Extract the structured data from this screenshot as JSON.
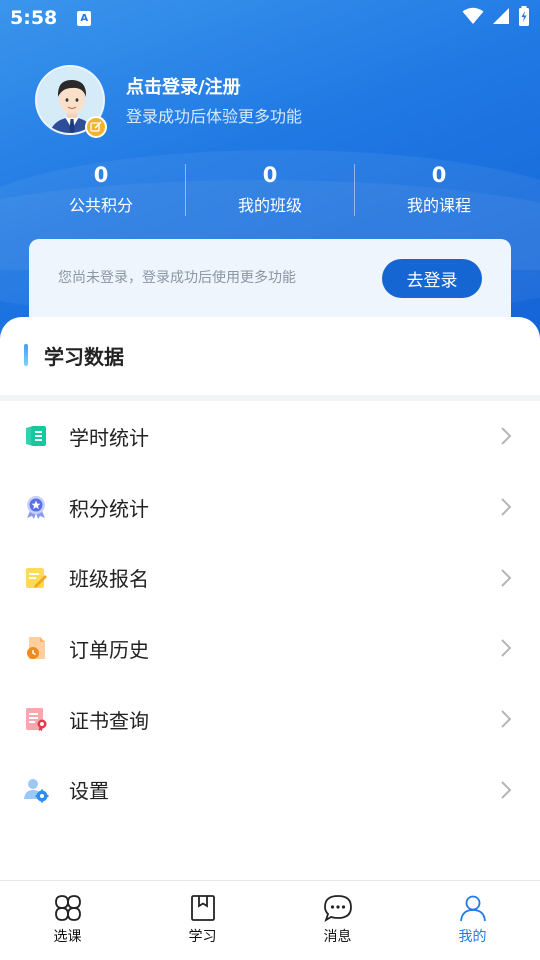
{
  "status_bar": {
    "time": "5:58",
    "notification_badge": "A"
  },
  "profile": {
    "title": "点击登录/注册",
    "subtitle": "登录成功后体验更多功能"
  },
  "stats": [
    {
      "value": "0",
      "label": "公共积分"
    },
    {
      "value": "0",
      "label": "我的班级"
    },
    {
      "value": "0",
      "label": "我的课程"
    }
  ],
  "login_prompt": {
    "text": "您尚未登录，登录成功后使用更多功能",
    "button": "去登录"
  },
  "section": {
    "title": "学习数据"
  },
  "menu": [
    {
      "label": "学时统计",
      "icon": "study-hours-icon"
    },
    {
      "label": "积分统计",
      "icon": "points-medal-icon"
    },
    {
      "label": "班级报名",
      "icon": "class-signup-icon"
    },
    {
      "label": "订单历史",
      "icon": "order-history-icon"
    },
    {
      "label": "证书查询",
      "icon": "certificate-icon"
    },
    {
      "label": "设置",
      "icon": "settings-user-icon"
    }
  ],
  "bottom_nav": [
    {
      "label": "选课",
      "icon": "course-select-icon",
      "active": false
    },
    {
      "label": "学习",
      "icon": "study-book-icon",
      "active": false
    },
    {
      "label": "消息",
      "icon": "message-icon",
      "active": false
    },
    {
      "label": "我的",
      "icon": "profile-icon",
      "active": true
    }
  ],
  "colors": {
    "accent": "#1f7be6",
    "hero_start": "#3a95ec",
    "hero_end": "#1463d6",
    "button": "#1565d2"
  }
}
